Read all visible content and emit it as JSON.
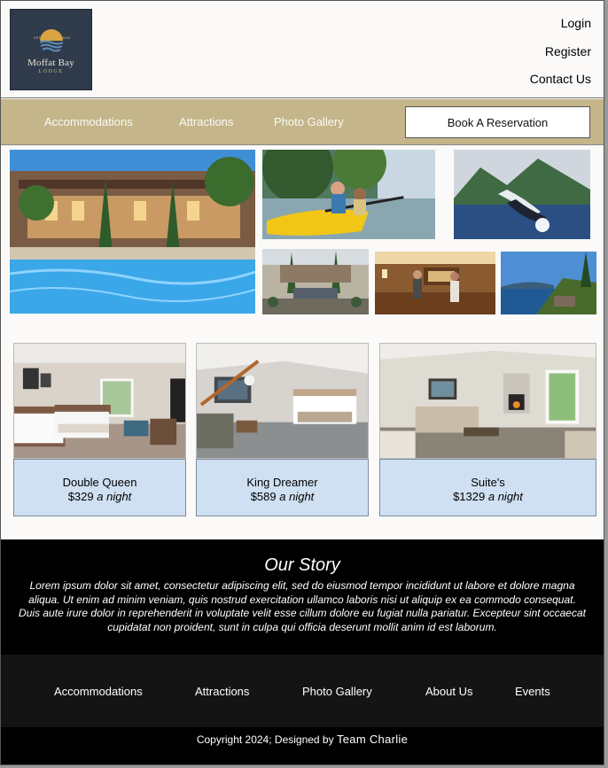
{
  "logo": {
    "name": "Moffat Bay",
    "sub": "LODGE",
    "est_left": "EST",
    "est_right": "2024"
  },
  "header": {
    "links": [
      "Login",
      "Register",
      "Contact Us"
    ]
  },
  "nav": {
    "links": [
      "Accommodations",
      "Attractions",
      "Photo Gallery"
    ],
    "book_button": "Book A Reservation"
  },
  "gallery": {
    "images": [
      "lodge-pool-photo",
      "kayaking-photo",
      "whale-breach-photo",
      "courtyard-photo",
      "front-desk-photo",
      "lake-view-photo"
    ]
  },
  "rooms": [
    {
      "name": "Double Queen",
      "price": "$329",
      "per": "a night"
    },
    {
      "name": "King Dreamer",
      "price": "$589",
      "per": "a night"
    },
    {
      "name": "Suite's",
      "price": "$1329",
      "per": "a night"
    }
  ],
  "story": {
    "title": "Our Story",
    "text": "Lorem ipsum dolor sit amet, consectetur adipiscing elit, sed do eiusmod tempor incididunt ut labore et dolore magna aliqua. Ut enim ad minim veniam, quis nostrud exercitation ullamco laboris nisi ut aliquip ex ea commodo consequat. Duis aute irure dolor in reprehenderit in voluptate velit esse cillum dolore eu fugiat nulla pariatur. Excepteur sint occaecat cupidatat non proident, sunt in culpa qui officia deserunt mollit anim id est laborum."
  },
  "footer": {
    "links": [
      "Accommodations",
      "Attractions",
      "Photo Gallery",
      "About Us",
      "Events"
    ],
    "copyright": "Copyright 2024; Designed by",
    "team": "Team Charlie"
  }
}
